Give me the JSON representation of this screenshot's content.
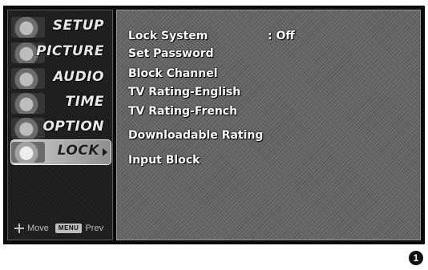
{
  "sidebar": {
    "items": [
      {
        "label": "SETUP",
        "icon": "setup-icon"
      },
      {
        "label": "PICTURE",
        "icon": "picture-icon"
      },
      {
        "label": "AUDIO",
        "icon": "audio-icon"
      },
      {
        "label": "TIME",
        "icon": "time-icon"
      },
      {
        "label": "OPTION",
        "icon": "option-icon"
      },
      {
        "label": "LOCK",
        "icon": "lock-icon",
        "active": true
      }
    ],
    "hints": {
      "move_label": "Move",
      "menu_key": "MENU",
      "prev_label": "Prev"
    }
  },
  "main": {
    "lock_system": {
      "label": "Lock System",
      "value": ": Off"
    },
    "options": [
      "Set Password",
      "Block Channel",
      "TV Rating-English",
      "TV Rating-French",
      "Downloadable Rating",
      "Input Block"
    ]
  },
  "step_badge": "1"
}
